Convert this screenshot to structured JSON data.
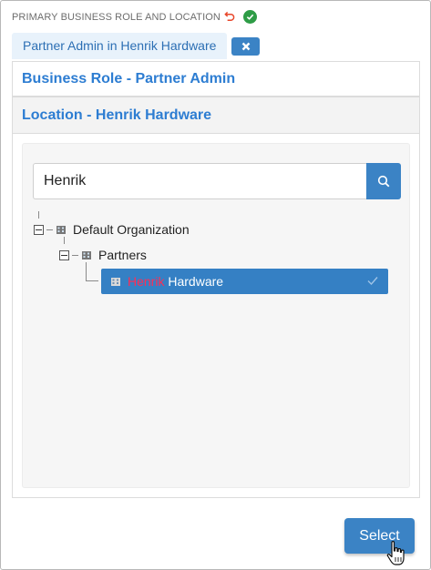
{
  "header": {
    "title": "PRIMARY BUSINESS ROLE AND LOCATION",
    "undo_icon": "undo-icon",
    "status_icon": "check-circle-icon",
    "status_color": "#2e9c46"
  },
  "chip": {
    "label": "Partner Admin in Henrik Hardware",
    "remove_icon": "close-icon"
  },
  "accordion": {
    "business_role": "Business Role - Partner Admin",
    "location": "Location - Henrik Hardware"
  },
  "search": {
    "value": "Henrik",
    "icon": "search-icon"
  },
  "tree": {
    "root": {
      "label": "Default Organization",
      "icon": "building-icon"
    },
    "child": {
      "label": "Partners",
      "icon": "building-icon"
    },
    "leaf": {
      "highlight": "Henrik",
      "rest": " Hardware",
      "icon": "building-icon",
      "selected": true
    }
  },
  "footer": {
    "select_label": "Select"
  },
  "colors": {
    "accent": "#3b83c5",
    "link_blue": "#2d7dd2",
    "highlight": "#ff2d55",
    "selected_bg": "#3580c4"
  }
}
